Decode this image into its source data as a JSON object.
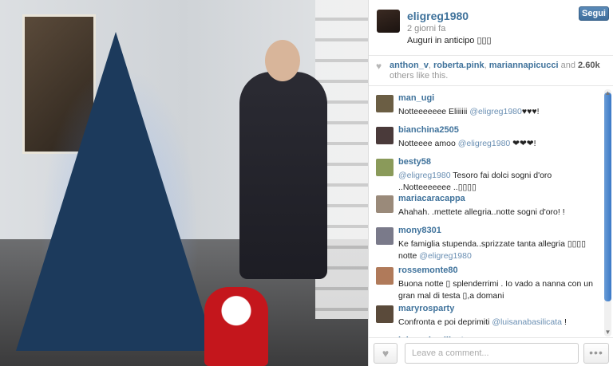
{
  "post": {
    "username": "eligreg1980",
    "time_ago": "2 giorni fa",
    "caption": "Auguri in anticipo ▯▯▯",
    "follow_label": "Segui"
  },
  "likes": {
    "heart_icon": "heart-icon",
    "names": [
      "anthon_v",
      "roberta.pink",
      "mariannapicucci"
    ],
    "sep": ", ",
    "and_text": " and ",
    "count": "2.60k",
    "suffix": " others like this."
  },
  "comments": [
    {
      "user": "man_ugi",
      "pre": "Notteeeeeee Eliiiiii ",
      "mention": "@eligreg1980",
      "post": "♥♥♥!"
    },
    {
      "user": "bianchina2505",
      "pre": "Notteeee amoo ",
      "mention": "@eligreg1980",
      "post": " ❤❤❤!"
    },
    {
      "user": "besty58",
      "pre": "",
      "mention": "@eligreg1980",
      "post": " Tesoro fai dolci sogni d'oro ..Notteeeeeee ..▯▯▯▯"
    },
    {
      "user": "mariacaracappa",
      "pre": "Ahahah. .mettete allegria..notte sogni d'oro! !",
      "mention": "",
      "post": ""
    },
    {
      "user": "mony8301",
      "pre": "Ke famiglia stupenda..sprizzate tanta allegria ▯▯▯▯ notte ",
      "mention": "@eligreg1980",
      "post": ""
    },
    {
      "user": "rossemonte80",
      "pre": "Buona notte ▯ splenderrimi . Io vado a nanna con un gran mal di testa ▯,a domani",
      "mention": "",
      "post": ""
    },
    {
      "user": "maryrosparty",
      "pre": "Confronta e poi deprimiti ",
      "mention": "@luisanabasilicata",
      "post": " !"
    },
    {
      "user": "luisanabasilicata",
      "pre": "",
      "mention": "",
      "post": ""
    }
  ],
  "footer": {
    "comment_placeholder": "Leave a comment...",
    "more_label": "•••"
  },
  "colors": {
    "link": "#3f729b",
    "follow_bg": "#3f6e9c",
    "scroll_thumb": "#3b78c6"
  }
}
